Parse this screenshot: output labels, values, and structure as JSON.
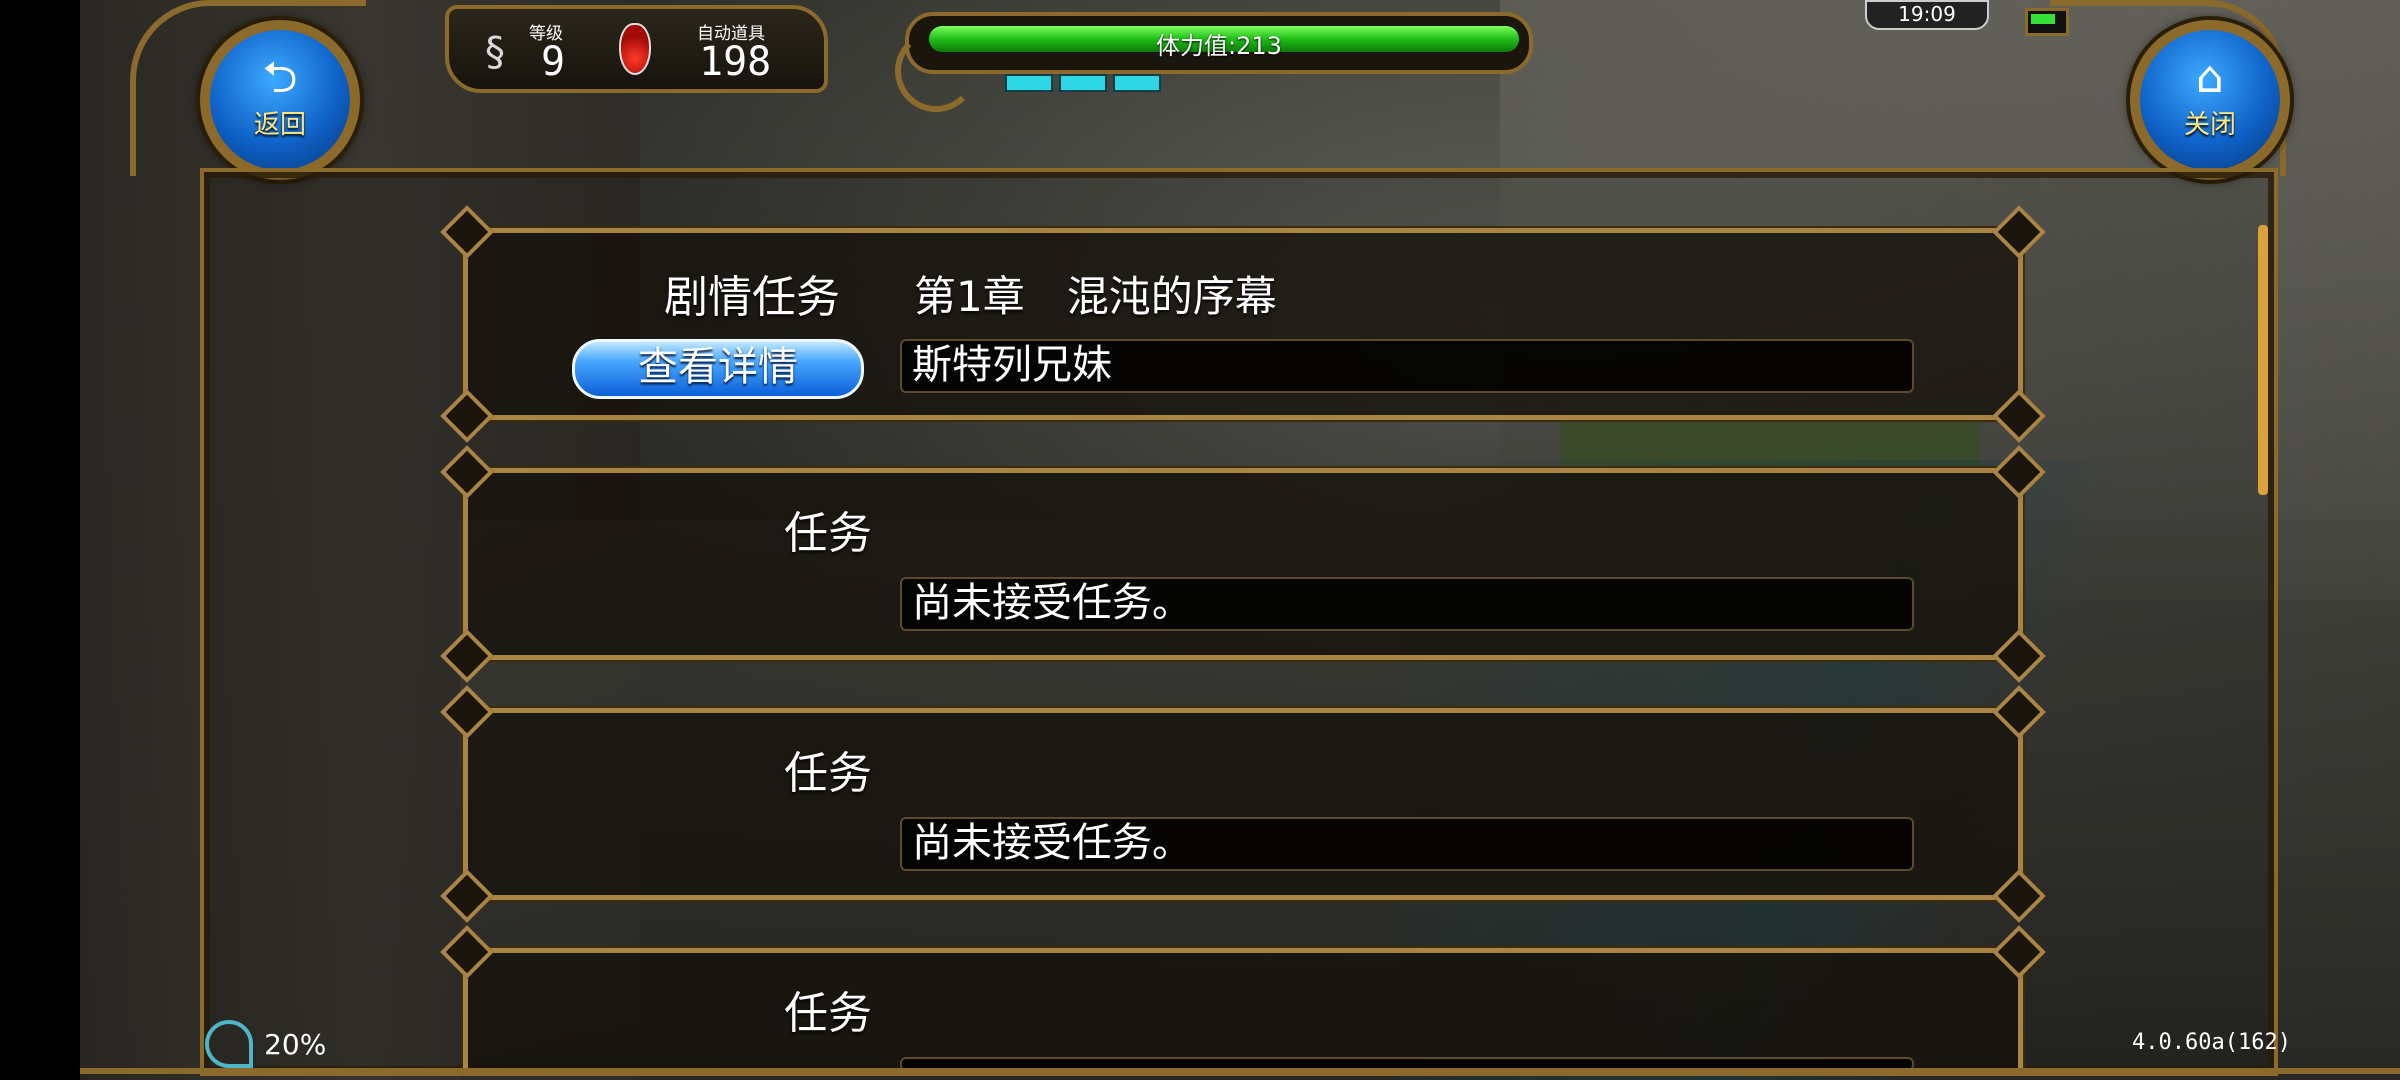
{
  "hud": {
    "back_label": "返回",
    "close_label": "关闭",
    "level_label": "等级",
    "level_value": "9",
    "auto_item_label": "自动道具",
    "auto_item_value": "198",
    "stamina_text": "体力值:213",
    "stamina_fraction": 1.0,
    "time": "19:09",
    "network_percent": "20%",
    "version": "4.0.60a(162)"
  },
  "quests": [
    {
      "title": "剧情任务",
      "chapter": "第1章　混沌的序幕",
      "detail_label": "查看详情",
      "value": "斯特列兄妹"
    },
    {
      "title": "任务",
      "value": "尚未接受任务。"
    },
    {
      "title": "任务",
      "value": "尚未接受任务。"
    },
    {
      "title": "任务",
      "value": ""
    }
  ],
  "colors": {
    "frame_gold": "#8c6a2b",
    "stamina_green": "#1fbf17",
    "button_blue": "#0a5fd8"
  }
}
